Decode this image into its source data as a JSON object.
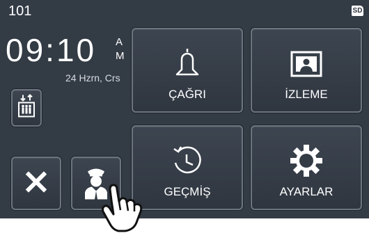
{
  "status": {
    "unit_number": "101",
    "time": "09:10",
    "ampm_a": "A",
    "ampm_m": "M",
    "date_line": "24 Hzrn, Crs",
    "sd_badge": "SD"
  },
  "menu": {
    "call_label": "ÇAĞRI",
    "monitor_label": "İZLEME",
    "history_label": "GEÇMİŞ",
    "settings_label": "AYARLAR"
  },
  "icons": {
    "call": "bell-icon",
    "monitor": "portrait-icon",
    "history": "clock-history-icon",
    "settings": "gear-icon",
    "elevator": "elevator-icon",
    "close": "close-icon",
    "concierge": "concierge-icon",
    "pointer": "pointing-hand-icon"
  },
  "colors": {
    "screen_bg": "#333b45",
    "button_border": "#6b747f",
    "text": "#ffffff"
  }
}
